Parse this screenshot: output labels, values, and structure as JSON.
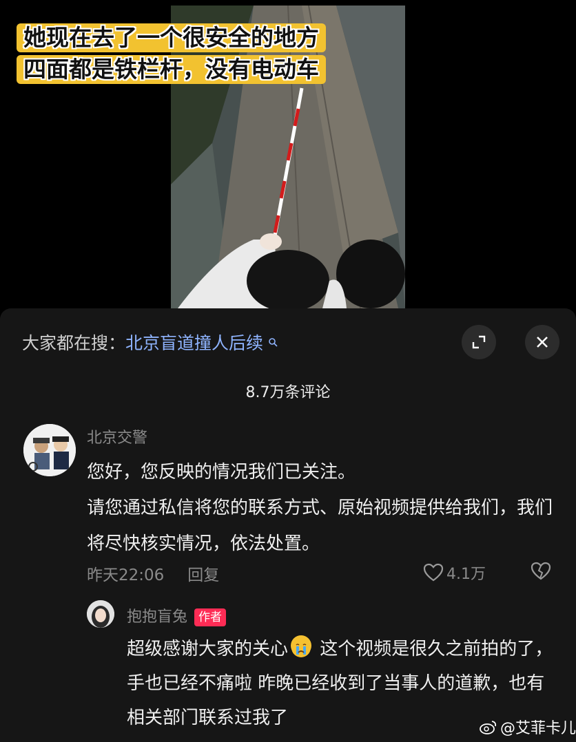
{
  "video": {
    "caption_line1": "她现在去了一个很安全的地方",
    "caption_line2": "四面都是铁栏杆，没有电动车"
  },
  "comments_panel": {
    "search_prefix": "大家都在搜：",
    "search_query": "北京盲道撞人后续",
    "comment_count": "8.7万条评论",
    "icons": [
      "search-icon",
      "expand-icon",
      "close-icon"
    ]
  },
  "comment": {
    "author": "北京交警",
    "text_line1": "您好，您反映的情况我们已关注。",
    "text_line2": "请您通过私信将您的联系方式、原始视频提供给我们，我们将尽快核实情况，依法处置。",
    "time": "昨天22:06",
    "reply_label": "回复",
    "likes": "4.1万"
  },
  "reply": {
    "author": "抱抱盲兔",
    "badge": "作者",
    "text_before_emoji": "超级感谢大家的关心",
    "emoji": "crying-face-emoji",
    "text_after_emoji": " 这个视频是很久之前拍的了，手也已经不痛啦 昨晚已经收到了当事人的道歉，也有相关部门联系过我了"
  },
  "watermark": {
    "text": "@艾菲卡儿",
    "icon": "weibo-icon"
  },
  "colors": {
    "caption_bg": "#f2c230",
    "link": "#8fb4ff",
    "author_badge": "#fe2c55",
    "sheet_bg": "#161616"
  }
}
